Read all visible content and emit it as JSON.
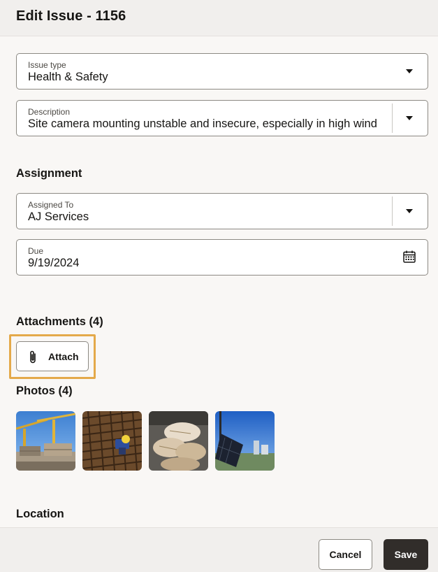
{
  "header": {
    "title": "Edit Issue - 1156"
  },
  "issue_type": {
    "label": "Issue type",
    "value": "Health & Safety"
  },
  "description": {
    "label": "Description",
    "value": "Site camera mounting unstable and insecure, especially in high winds"
  },
  "assignment": {
    "title": "Assignment",
    "assigned_to": {
      "label": "Assigned To",
      "value": "AJ Services"
    },
    "due": {
      "label": "Due",
      "value": "9/19/2024"
    }
  },
  "attachments": {
    "title": "Attachments (4)",
    "attach_label": "Attach"
  },
  "photos": {
    "title": "Photos (4)",
    "items": [
      {
        "subject": "construction-cranes"
      },
      {
        "subject": "rebar-worker"
      },
      {
        "subject": "sandbags"
      },
      {
        "subject": "solar-panel-camera"
      }
    ]
  },
  "location": {
    "title": "Location"
  },
  "footer": {
    "cancel_label": "Cancel",
    "save_label": "Save"
  },
  "colors": {
    "focus_ring": "#e4a94a",
    "primary_button": "#312d2a",
    "background": "#f9f7f5",
    "header_bg": "#f1efed"
  },
  "icons": {
    "dropdown": "caret-down-icon",
    "calendar": "calendar-icon",
    "attach": "paperclip-icon"
  }
}
